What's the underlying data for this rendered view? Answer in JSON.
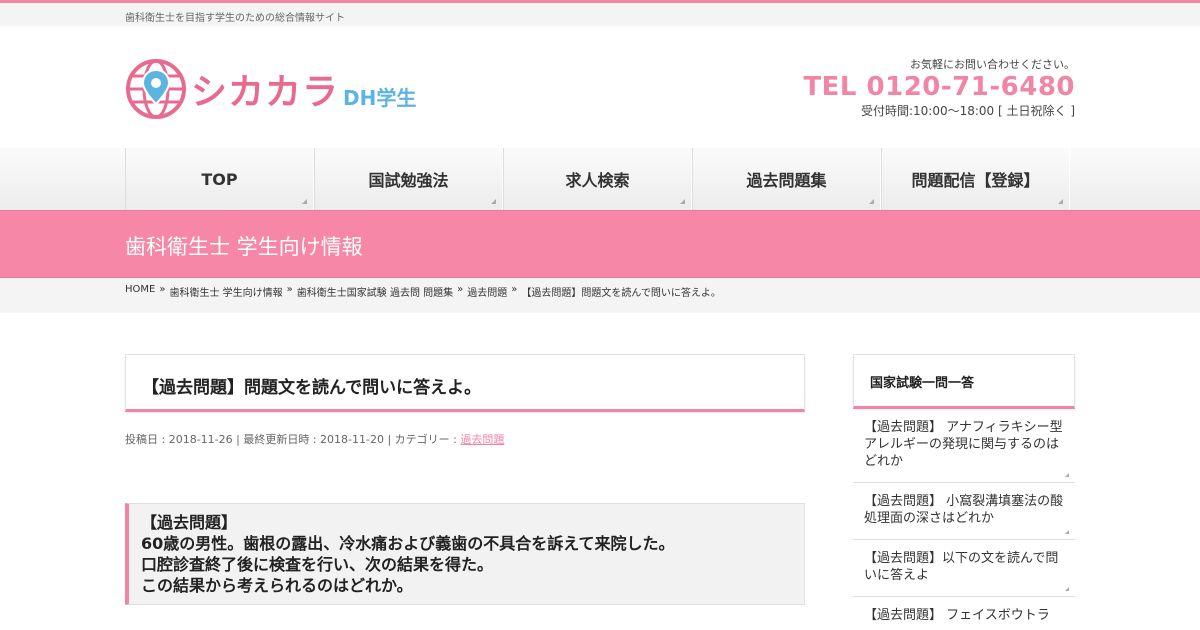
{
  "site": {
    "tagline": "歯科衛生士を目指す学生のための総合情報サイト",
    "logo_text": "シカカラ",
    "logo_sub": "DH学生",
    "brand_color": "#f284a4",
    "accent_color": "#5cb4e2"
  },
  "contact": {
    "note": "お気軽にお問い合わせください。",
    "tel": "TEL 0120-71-6480",
    "hours": "受付時間:10:00～18:00 [ 土日祝除く ]"
  },
  "nav": {
    "items": [
      {
        "label": "TOP"
      },
      {
        "label": "国試勉強法"
      },
      {
        "label": "求人検索"
      },
      {
        "label": "過去問題集"
      },
      {
        "label": "問題配信【登録】"
      }
    ]
  },
  "banner": {
    "title": "歯科衛生士 学生向け情報"
  },
  "breadcrumb": {
    "items": [
      {
        "label": "HOME"
      },
      {
        "label": "歯科衛生士 学生向け情報"
      },
      {
        "label": "歯科衛生士国家試験 過去問 問題集"
      },
      {
        "label": "過去問題"
      },
      {
        "label": "【過去問題】問題文を読んで問いに答えよ。"
      }
    ],
    "separator": "»"
  },
  "post": {
    "title": "【過去問題】問題文を読んで問いに答えよ。",
    "meta_prefix": "投稿日 : 2018-11-26 | 最終更新日時 : 2018-11-20 | カテゴリー : ",
    "category": "過去問題",
    "question_lines": [
      "【過去問題】",
      "60歳の男性。歯根の露出、冷水痛および義歯の不具合を訴えて来院した。",
      "口腔診査終了後に検査を行い、次の結果を得た。",
      "この結果から考えられるのはどれか。"
    ]
  },
  "sidebar": {
    "title": "国家試験一問一答",
    "items": [
      {
        "label": "【過去問題】 アナフィラキシー型アレルギーの発現に関与するのはどれか"
      },
      {
        "label": "【過去問題】 小窩裂溝填塞法の酸処理面の深さはどれか"
      },
      {
        "label": "【過去問題】以下の文を読んで問いに答えよ"
      },
      {
        "label": "【過去問題】 フェイスボウトラ"
      }
    ]
  }
}
